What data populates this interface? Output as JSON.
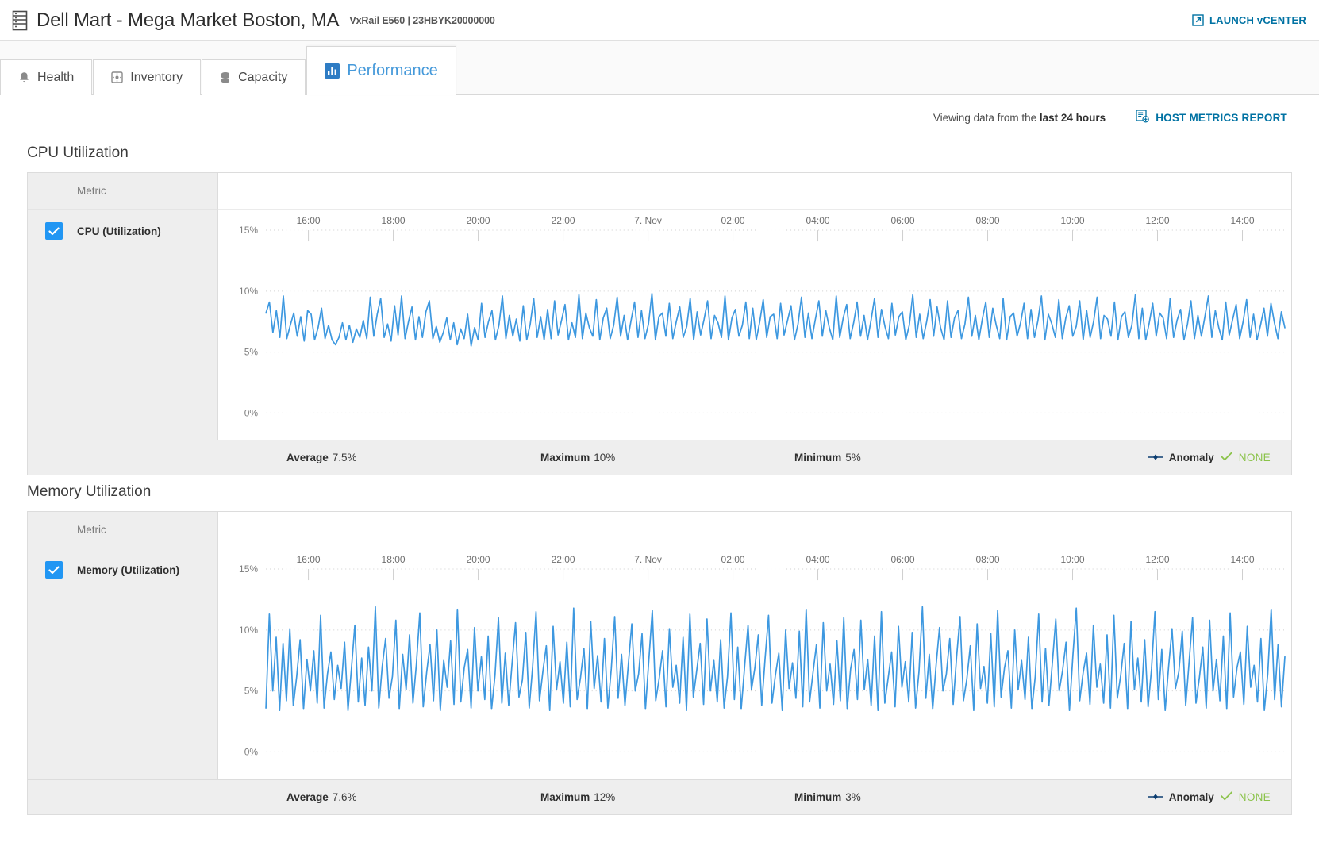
{
  "header": {
    "icon": "server-rack-icon",
    "title": "Dell Mart - Mega Market Boston, MA",
    "subtitle": "VxRail E560 | 23HBYK20000000",
    "launch_label": "LAUNCH vCENTER",
    "launch_icon": "external-link-icon"
  },
  "tabs": [
    {
      "label": "Health",
      "icon": "bell-icon",
      "active": false
    },
    {
      "label": "Inventory",
      "icon": "inventory-box-icon",
      "active": false
    },
    {
      "label": "Capacity",
      "icon": "database-icon",
      "active": false
    },
    {
      "label": "Performance",
      "icon": "bar-chart-icon",
      "active": true
    }
  ],
  "subbar": {
    "viewing_prefix": "Viewing data from the ",
    "viewing_range": "last 24 hours",
    "report_label": "HOST METRICS REPORT",
    "report_icon": "report-document-icon"
  },
  "colors": {
    "line": "#3d98e0",
    "accent": "#0072a3",
    "tab_active": "#4599da",
    "checkbox": "#2196f3",
    "anomaly_ok": "#8bc34a"
  },
  "sections": [
    {
      "title": "CPU Utilization",
      "metric_column_header": "Metric",
      "metric_label": "CPU (Utilization)",
      "checked": true,
      "stats": {
        "average_label": "Average",
        "average_value": "7.5%",
        "maximum_label": "Maximum",
        "maximum_value": "10%",
        "minimum_label": "Minimum",
        "minimum_value": "5%",
        "anomaly_label": "Anomaly",
        "anomaly_value": "NONE",
        "anomaly_icon": "anomaly-marker-icon",
        "anomaly_check_icon": "check-icon"
      }
    },
    {
      "title": "Memory Utilization",
      "metric_column_header": "Metric",
      "metric_label": "Memory (Utilization)",
      "checked": true,
      "stats": {
        "average_label": "Average",
        "average_value": "7.6%",
        "maximum_label": "Maximum",
        "maximum_value": "12%",
        "minimum_label": "Minimum",
        "minimum_value": "3%",
        "anomaly_label": "Anomaly",
        "anomaly_value": "NONE",
        "anomaly_icon": "anomaly-marker-icon",
        "anomaly_check_icon": "check-icon"
      }
    }
  ],
  "chart_data": [
    {
      "type": "line",
      "title": "CPU Utilization",
      "xlabel": "",
      "ylabel": "",
      "ylim": [
        0,
        15
      ],
      "yticks": [
        0,
        5,
        10,
        15
      ],
      "ytick_labels": [
        "0%",
        "5%",
        "10%",
        "15%"
      ],
      "xtick_labels": [
        "16:00",
        "18:00",
        "20:00",
        "22:00",
        "7. Nov",
        "02:00",
        "04:00",
        "06:00",
        "08:00",
        "10:00",
        "12:00",
        "14:00"
      ],
      "grid": true,
      "legend": "none",
      "series": [
        {
          "name": "CPU (Utilization)",
          "color": "#3d98e0",
          "values": [
            8.2,
            9.1,
            6.6,
            8.4,
            6.2,
            9.6,
            6.1,
            7.2,
            8.2,
            6.3,
            7.9,
            5.9,
            8.4,
            8.1,
            6.0,
            7.0,
            8.6,
            6.1,
            7.2,
            6.0,
            5.6,
            6.2,
            7.4,
            6.0,
            7.2,
            5.8,
            6.9,
            6.2,
            7.6,
            6.1,
            9.5,
            6.3,
            8.1,
            9.4,
            6.2,
            7.3,
            5.9,
            8.8,
            6.4,
            9.6,
            6.1,
            7.5,
            8.7,
            6.0,
            7.9,
            6.2,
            8.3,
            9.2,
            6.1,
            7.1,
            5.8,
            6.6,
            7.8,
            6.0,
            7.4,
            5.6,
            6.9,
            6.1,
            8.1,
            5.5,
            7.0,
            6.0,
            9.0,
            6.2,
            7.5,
            8.4,
            6.0,
            7.2,
            9.6,
            6.1,
            8.0,
            6.3,
            7.7,
            5.9,
            8.8,
            6.0,
            7.3,
            9.4,
            6.2,
            7.9,
            6.0,
            8.5,
            6.1,
            9.2,
            6.4,
            7.6,
            8.9,
            6.0,
            7.4,
            6.2,
            9.7,
            6.1,
            8.2,
            7.0,
            6.3,
            9.3,
            6.0,
            7.8,
            8.6,
            6.1,
            7.2,
            9.5,
            6.3,
            8.0,
            6.0,
            7.6,
            9.1,
            6.2,
            8.4,
            6.1,
            7.3,
            9.8,
            6.0,
            7.9,
            8.2,
            6.3,
            9.0,
            6.1,
            7.5,
            8.7,
            6.2,
            7.1,
            9.4,
            6.0,
            8.3,
            6.4,
            7.7,
            9.2,
            6.1,
            8.0,
            7.4,
            6.2,
            9.6,
            6.0,
            7.8,
            8.5,
            6.3,
            7.2,
            9.1,
            6.1,
            8.6,
            6.0,
            7.5,
            9.3,
            6.2,
            7.9,
            8.1,
            6.1,
            9.0,
            6.4,
            7.6,
            8.8,
            6.0,
            7.3,
            9.5,
            6.2,
            8.2,
            6.1,
            7.7,
            9.2,
            6.3,
            8.4,
            7.0,
            6.0,
            9.6,
            6.2,
            7.8,
            8.9,
            6.1,
            7.4,
            9.1,
            6.3,
            8.0,
            6.0,
            7.6,
            9.4,
            6.2,
            8.5,
            7.1,
            6.1,
            9.0,
            6.4,
            7.9,
            8.3,
            6.0,
            7.2,
            9.7,
            6.2,
            8.1,
            6.1,
            7.5,
            9.3,
            6.3,
            8.7,
            7.0,
            6.0,
            9.2,
            6.2,
            7.8,
            8.4,
            6.1,
            7.3,
            9.5,
            6.3,
            8.0,
            6.0,
            7.7,
            9.1,
            6.2,
            8.6,
            7.2,
            6.1,
            9.4,
            6.0,
            7.9,
            8.2,
            6.3,
            7.4,
            9.0,
            6.1,
            8.5,
            6.2,
            7.6,
            9.6,
            6.0,
            8.1,
            7.3,
            6.2,
            9.3,
            6.1,
            7.8,
            8.8,
            6.3,
            7.1,
            9.2,
            6.0,
            8.4,
            6.2,
            7.5,
            9.5,
            6.1,
            8.0,
            7.7,
            6.3,
            9.1,
            6.0,
            7.9,
            8.3,
            6.2,
            7.2,
            9.7,
            6.1,
            8.6,
            6.0,
            7.4,
            9.0,
            6.3,
            8.2,
            7.8,
            6.1,
            9.4,
            6.2,
            7.6,
            8.5,
            6.0,
            7.3,
            9.2,
            6.1,
            8.0,
            6.3,
            7.9,
            9.6,
            6.2,
            8.4,
            7.0,
            6.0,
            9.1,
            6.4,
            7.7,
            8.9,
            6.1,
            7.5,
            9.3,
            6.2,
            8.1,
            6.0,
            7.2,
            8.6,
            6.3,
            9.0,
            7.4,
            6.1,
            8.3,
            7.0
          ]
        }
      ]
    },
    {
      "type": "line",
      "title": "Memory Utilization",
      "xlabel": "",
      "ylabel": "",
      "ylim": [
        0,
        15
      ],
      "yticks": [
        0,
        5,
        10,
        15
      ],
      "ytick_labels": [
        "0%",
        "5%",
        "10%",
        "15%"
      ],
      "xtick_labels": [
        "16:00",
        "18:00",
        "20:00",
        "22:00",
        "7. Nov",
        "02:00",
        "04:00",
        "06:00",
        "08:00",
        "10:00",
        "12:00",
        "14:00"
      ],
      "grid": true,
      "legend": "none",
      "series": [
        {
          "name": "Memory (Utilization)",
          "color": "#3d98e0",
          "values": [
            3.6,
            11.3,
            5.0,
            9.4,
            3.4,
            8.9,
            4.2,
            10.1,
            3.8,
            6.2,
            9.2,
            3.5,
            7.6,
            5.0,
            8.3,
            4.0,
            11.2,
            3.6,
            6.4,
            8.2,
            4.3,
            7.1,
            5.2,
            9.0,
            3.4,
            6.8,
            10.4,
            4.1,
            7.7,
            3.8,
            8.6,
            5.0,
            11.9,
            3.6,
            7.0,
            9.3,
            4.4,
            6.2,
            10.8,
            3.5,
            8.0,
            5.1,
            9.6,
            4.0,
            7.2,
            11.4,
            3.7,
            6.5,
            8.8,
            4.2,
            10.0,
            3.4,
            7.5,
            5.3,
            9.1,
            3.9,
            11.7,
            4.1,
            6.9,
            8.4,
            3.6,
            10.2,
            5.0,
            7.8,
            4.3,
            9.5,
            3.5,
            6.3,
            11.0,
            4.0,
            8.1,
            3.8,
            7.3,
            10.6,
            4.5,
            5.9,
            9.8,
            3.6,
            7.0,
            11.5,
            4.2,
            6.6,
            8.7,
            3.4,
            10.3,
            5.1,
            7.4,
            4.0,
            9.0,
            3.7,
            11.8,
            4.3,
            6.1,
            8.5,
            3.5,
            10.7,
            5.2,
            7.9,
            4.1,
            9.3,
            3.6,
            6.8,
            11.1,
            4.4,
            8.0,
            3.8,
            7.2,
            10.5,
            5.0,
            6.4,
            9.7,
            3.5,
            7.6,
            11.6,
            4.2,
            6.0,
            8.3,
            3.7,
            10.1,
            5.3,
            7.1,
            4.0,
            9.4,
            3.4,
            11.3,
            4.5,
            6.7,
            8.9,
            3.9,
            10.9,
            5.0,
            7.5,
            4.1,
            9.2,
            3.6,
            6.2,
            11.4,
            4.3,
            8.6,
            3.5,
            7.0,
            10.4,
            5.1,
            6.9,
            9.6,
            3.8,
            7.7,
            11.2,
            4.0,
            6.3,
            8.1,
            3.4,
            10.0,
            5.2,
            7.3,
            4.4,
            9.9,
            3.7,
            11.7,
            4.1,
            6.5,
            8.8,
            3.6,
            10.6,
            5.0,
            7.2,
            3.9,
            9.1,
            4.2,
            11.0,
            3.5,
            6.8,
            8.4,
            4.3,
            10.8,
            5.1,
            7.6,
            3.8,
            9.5,
            3.4,
            11.5,
            4.0,
            6.1,
            8.2,
            3.7,
            10.3,
            5.3,
            7.4,
            4.1,
            9.8,
            3.6,
            6.6,
            11.9,
            4.4,
            8.0,
            3.5,
            7.1,
            10.2,
            5.0,
            6.4,
            9.3,
            3.9,
            7.8,
            11.1,
            4.2,
            6.0,
            8.7,
            3.4,
            10.5,
            5.2,
            7.0,
            4.0,
            9.7,
            3.7,
            11.6,
            4.5,
            6.9,
            8.3,
            3.6,
            10.0,
            5.1,
            7.5,
            4.3,
            9.4,
            3.5,
            6.2,
            11.3,
            4.1,
            8.5,
            3.8,
            7.3,
            10.9,
            5.0,
            6.7,
            9.0,
            3.4,
            7.9,
            11.8,
            4.2,
            6.5,
            8.1,
            3.9,
            10.4,
            5.3,
            7.2,
            4.0,
            9.6,
            3.6,
            11.2,
            4.4,
            6.3,
            8.9,
            3.5,
            10.7,
            5.1,
            7.7,
            4.1,
            9.2,
            3.7,
            6.8,
            11.5,
            4.3,
            8.4,
            3.4,
            7.0,
            10.1,
            5.2,
            6.6,
            9.9,
            3.8,
            7.4,
            11.0,
            4.0,
            6.1,
            8.6,
            3.6,
            10.8,
            5.0,
            7.6,
            4.2,
            9.5,
            3.5,
            11.4,
            4.5,
            6.9,
            8.2,
            3.9,
            10.3,
            5.3,
            7.1,
            4.1,
            9.3,
            3.4,
            6.4,
            11.7,
            4.3,
            8.8,
            3.7,
            7.8
          ]
        }
      ]
    }
  ]
}
